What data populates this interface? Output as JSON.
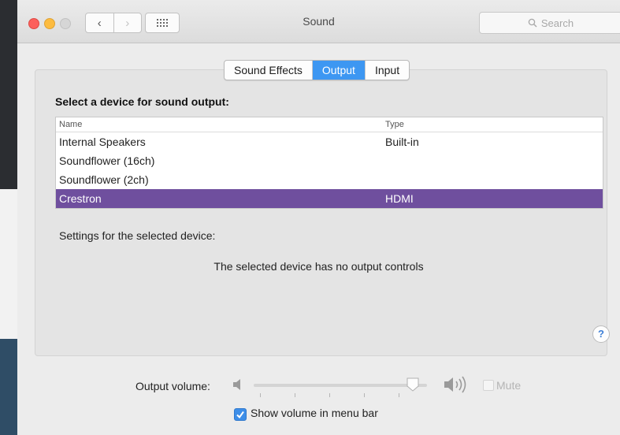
{
  "window": {
    "title": "Sound",
    "search_placeholder": "Search"
  },
  "tabs": [
    {
      "label": "Sound Effects",
      "selected": false
    },
    {
      "label": "Output",
      "selected": true
    },
    {
      "label": "Input",
      "selected": false
    }
  ],
  "output": {
    "heading": "Select a device for sound output:",
    "columns": {
      "name": "Name",
      "type": "Type"
    },
    "devices": [
      {
        "name": "Internal Speakers",
        "type": "Built-in",
        "selected": false
      },
      {
        "name": "Soundflower (16ch)",
        "type": "",
        "selected": false
      },
      {
        "name": "Soundflower (2ch)",
        "type": "",
        "selected": false
      },
      {
        "name": "Crestron",
        "type": "HDMI",
        "selected": true
      }
    ],
    "settings_label": "Settings for the selected device:",
    "no_controls_message": "The selected device has no output controls",
    "help_label": "?"
  },
  "volume": {
    "label": "Output volume:",
    "level": 0.93,
    "mute_label": "Mute",
    "mute_checked": false,
    "mute_enabled": false
  },
  "menu_bar": {
    "label": "Show volume in menu bar",
    "checked": true
  },
  "colors": {
    "selected_tab": "#3d97f2",
    "selected_row": "#6f4f9e",
    "checkbox": "#3d8ee8"
  }
}
